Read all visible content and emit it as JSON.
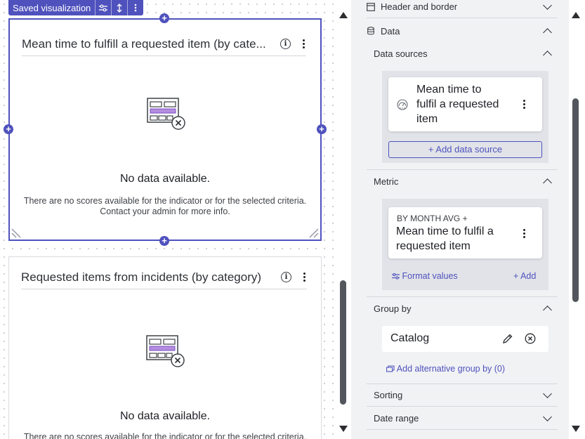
{
  "toolbar_tab": {
    "label": "Saved visualization",
    "actions": [
      "filter-sliders-icon",
      "vertical-resize-icon",
      "more-vertical-icon"
    ]
  },
  "widgets": [
    {
      "title": "Mean time to fulfill a requested item (by cate...",
      "selected": true,
      "empty_title": "No data available.",
      "empty_line1": "There are no scores available for the indicator or for the selected criteria.",
      "empty_line2": "Contact your admin for more info."
    },
    {
      "title": "Requested items from incidents (by category)",
      "selected": false,
      "empty_title": "No data available.",
      "empty_line1": "There are no scores available for the indicator or for the selected criteria."
    }
  ],
  "panel": {
    "header_border": "Header and border",
    "data": "Data",
    "data_sources": {
      "label": "Data sources",
      "item_line1": "Mean time to",
      "item_line2": "fulfil a requested",
      "item_line3": "item",
      "add_label": "+ Add data source"
    },
    "metric": {
      "label": "Metric",
      "item_prefix": "BY MONTH AVG +",
      "item_line1": "Mean time to fulfil a",
      "item_line2": "requested item",
      "format_label": "Format values",
      "add_label": "+ Add"
    },
    "group_by": {
      "label": "Group by",
      "value": "Catalog",
      "alt_label": "Add alternative group by (0)"
    },
    "sorting": "Sorting",
    "date_range": "Date range"
  },
  "colors": {
    "accent": "#4f52bd",
    "panel_bg": "#f1f2f4",
    "subpanel_bg": "#e1e3e8"
  }
}
